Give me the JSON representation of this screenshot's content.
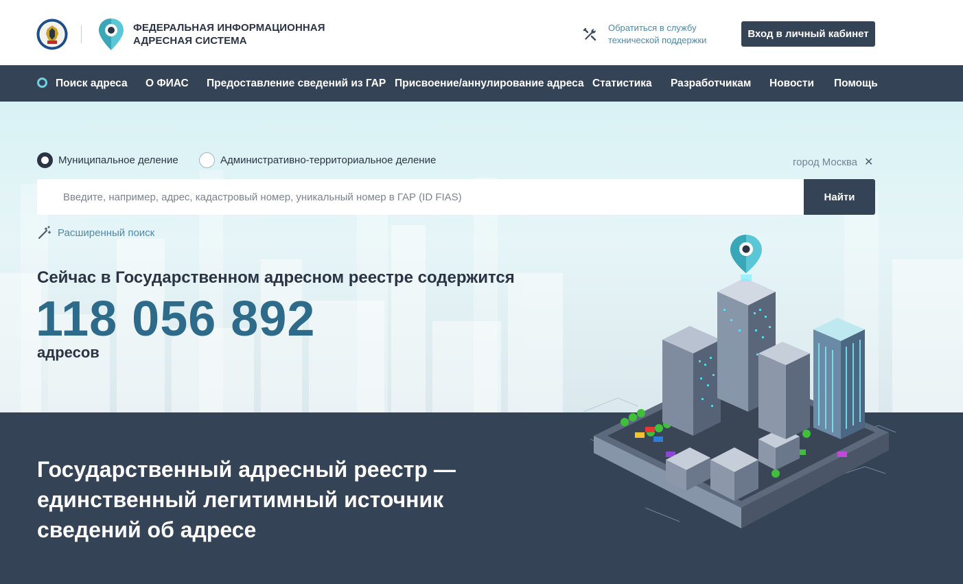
{
  "header": {
    "brand_line1": "ФЕДЕРАЛЬНАЯ ИНФОРМАЦИОННАЯ",
    "brand_line2": "АДРЕСНАЯ СИСТЕМА",
    "support_line1": "Обратиться в службу",
    "support_line2": "технической поддержки",
    "login_label": "Вход в личный кабинет"
  },
  "nav": {
    "items": [
      {
        "label": "Поиск адреса",
        "active": true
      },
      {
        "label": "О ФИАС"
      },
      {
        "label": "Предоставление сведений из ГАР"
      },
      {
        "label": "Присвоение/аннулирование адреса"
      },
      {
        "label": "Статистика"
      },
      {
        "label": "Разработчикам"
      },
      {
        "label": "Новости"
      },
      {
        "label": "Помощь"
      }
    ]
  },
  "search": {
    "division_options": [
      {
        "label": "Муниципальное деление",
        "selected": true
      },
      {
        "label": "Административно-территориальное деление",
        "selected": false
      }
    ],
    "region_filter": "город Москва",
    "placeholder": "Введите, например, адрес, кадастровый номер, уникальный номер в ГАР (ID FIAS)",
    "value": "",
    "find_label": "Найти",
    "advanced_label": "Расширенный поиск"
  },
  "stats": {
    "title": "Сейчас в Государственном адресном реестре содержится",
    "count": "118 056 892",
    "unit": "адресов"
  },
  "slogan": {
    "line1": "Государственный адресный реестр —",
    "line2": "единственный легитимный источник",
    "line3": "сведений об адресе"
  },
  "colors": {
    "primary_dark": "#354357",
    "accent_blue": "#2e6a8a",
    "link_blue": "#4f88a6",
    "cyan": "#6fd1e0"
  },
  "icons": {
    "emblem": "fns-emblem-icon",
    "logo": "map-pin-logo-icon",
    "support": "tools-icon",
    "close": "close-icon",
    "advanced": "magic-wand-icon"
  }
}
